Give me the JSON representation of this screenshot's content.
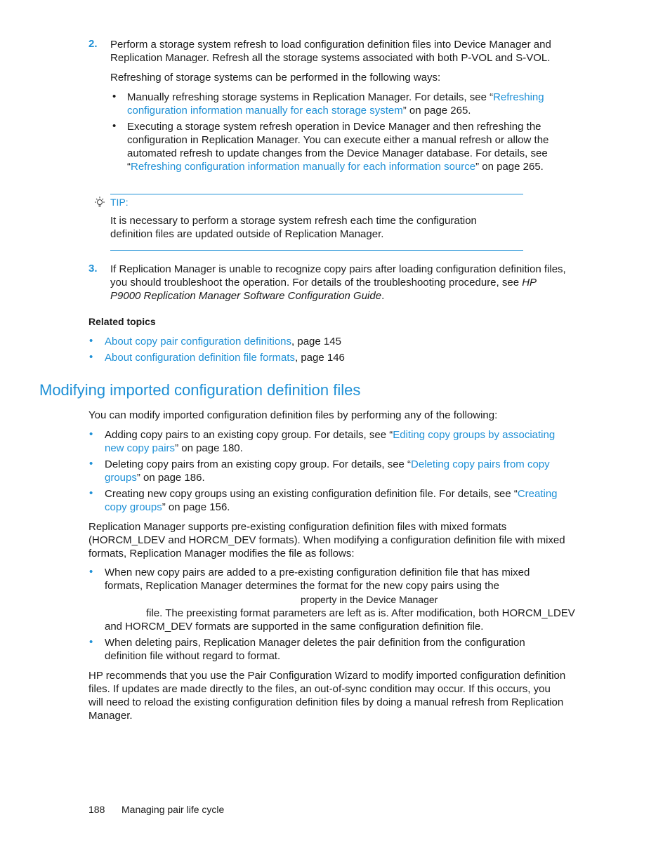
{
  "steps": {
    "step2": {
      "number": "2.",
      "text": "Perform a storage system refresh to load configuration definition files into Device Manager and Replication Manager. Refresh all the storage systems associated with both P-VOL and S-VOL.",
      "sub": "Refreshing of storage systems can be performed in the following ways:",
      "bullets": [
        {
          "pre": "Manually refreshing storage systems in Replication Manager. For details, see “",
          "link": "Refreshing configuration information manually for each storage system",
          "post": "” on page 265."
        },
        {
          "pre": "Executing a storage system refresh operation in Device Manager and then refreshing the configuration in Replication Manager. You can execute either a manual refresh or allow the automated refresh to update changes from the Device Manager database. For details, see “",
          "link": "Refreshing configuration information manually for each information source",
          "post": "” on page 265."
        }
      ]
    },
    "tip": {
      "label": "TIP:",
      "text": "It is necessary to perform a storage system refresh each time the configuration definition files are updated outside of Replication Manager."
    },
    "step3": {
      "number": "3.",
      "pre": "If Replication Manager is unable to recognize copy pairs after loading configuration definition files, you should troubleshoot the operation. For details of the troubleshooting procedure, see ",
      "italic": "HP P9000 Replication Manager Software Configuration Guide",
      "post": "."
    }
  },
  "related": {
    "heading": "Related topics",
    "items": [
      {
        "link": "About copy pair configuration definitions",
        "post": ", page 145"
      },
      {
        "link": "About configuration definition file formats",
        "post": ", page 146"
      }
    ]
  },
  "section": {
    "title": "Modifying imported configuration definition files",
    "intro": "You can modify imported configuration definition files by performing any of the following:",
    "bullets": [
      {
        "pre": "Adding copy pairs to an existing copy group. For details, see “",
        "link": "Editing copy groups by associating new copy pairs",
        "post": "” on page 180."
      },
      {
        "pre": "Deleting copy pairs from an existing copy group. For details, see “",
        "link": "Deleting copy pairs from copy groups",
        "post": "” on page 186."
      },
      {
        "pre": "Creating new copy groups using an existing configuration definition file. For details, see “",
        "link": "Creating copy groups",
        "post": "” on page 156."
      }
    ],
    "para2": "Replication Manager supports pre-existing configuration definition files with mixed formats (HORCM_LDEV and HORCM_DEV formats). When modifying a configuration definition file with mixed formats, Replication Manager modifies the file as follows:",
    "bullets2": [
      {
        "line1": "When new copy pairs are added to a pre-existing configuration definition file that has mixed",
        "line2": "formats, Replication Manager determines the format for the new copy pairs using the",
        "line3": "property in the Device Manager",
        "line4": "file. The preexisting format parameters are left as is. After modification, both HORCM_LDEV",
        "line5": "and HORCM_DEV formats are supported in the same configuration definition file."
      },
      {
        "text": "When deleting pairs, Replication Manager deletes the pair definition from the configuration definition file without regard to format."
      }
    ],
    "para3": "HP recommends that you use the Pair Configuration Wizard to modify imported configuration definition files. If updates are made directly to the files, an out-of-sync condition may occur. If this occurs, you will need to reload the existing configuration definition files by doing a manual refresh from Replication Manager."
  },
  "footer": {
    "page_number": "188",
    "chapter": "Managing pair life cycle"
  },
  "colors": {
    "accent": "#1e90d6",
    "text": "#1a1a1a"
  }
}
